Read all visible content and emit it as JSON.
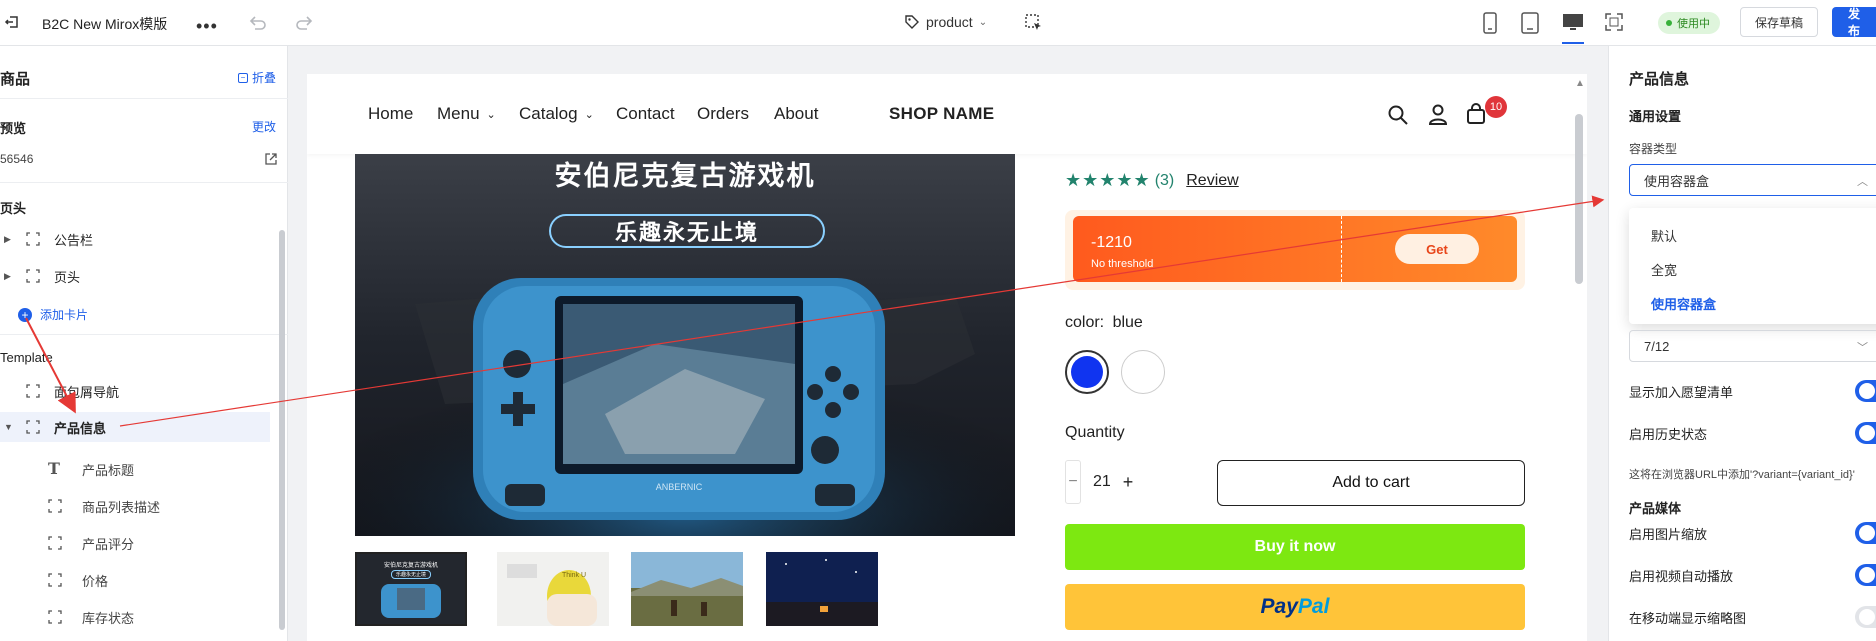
{
  "app": {
    "title": "B2C New Mirox模版",
    "page_selector": "product",
    "status": "使用中",
    "save_draft": "保存草稿",
    "publish": "发布"
  },
  "left_panel": {
    "header": "商品",
    "collapse": "折叠",
    "preview_label": "预览",
    "change": "更改",
    "product_id": "56546",
    "section_header": "页头",
    "header_items": [
      "公告栏",
      "页头"
    ],
    "add_card": "添加卡片",
    "template_label": "Template",
    "template_items": [
      "面包屑导航",
      "产品信息"
    ],
    "sub_items": [
      "产品标题",
      "商品列表描述",
      "产品评分",
      "价格",
      "库存状态"
    ]
  },
  "canvas": {
    "nav": [
      "Home",
      "Menu",
      "Catalog",
      "Contact",
      "Orders",
      "About"
    ],
    "shop_name": "SHOP NAME",
    "cart_count": "10",
    "hero_title": "安伯尼克复古游戏机",
    "hero_pill": "乐趣永无止境",
    "device_brand": "ANBERNIC",
    "rating_count": "(3)",
    "review_link": "Review",
    "coupon_amount": "-1210",
    "coupon_sub": "No threshold",
    "coupon_btn": "Get",
    "color_label": "color:",
    "color_value": "blue",
    "quantity_label": "Quantity",
    "quantity_value": "21",
    "minus": "−",
    "plus": "+",
    "add_to_cart": "Add to cart",
    "buy_now": "Buy it now",
    "paypal_pay": "Pay",
    "paypal_pal": "Pal",
    "thumb1_line1": "安伯尼克复古游戏机",
    "thumb1_line2": "乐趣永无止境",
    "thumb2_text": "Think U"
  },
  "right_panel": {
    "title": "产品信息",
    "general": "通用设置",
    "container_label": "容器类型",
    "container_value": "使用容器盒",
    "dropdown_options": [
      "默认",
      "全宽",
      "使用容器盒"
    ],
    "layout_value": "7/12",
    "toggles": [
      {
        "label": "显示加入愿望清单",
        "on": true
      },
      {
        "label": "启用历史状态",
        "on": true
      }
    ],
    "hint": "这将在浏览器URL中添加'?variant={variant_id}'",
    "media_header": "产品媒体",
    "media_toggles": [
      {
        "label": "启用图片缩放",
        "on": true
      },
      {
        "label": "启用视频自动播放",
        "on": true
      },
      {
        "label": "在移动端显示缩略图",
        "on": false
      }
    ]
  },
  "colors": {
    "accent": "#1f5fe8",
    "buy_now": "#7de811",
    "paypal": "#ffc439",
    "coupon": "#ff5a1e",
    "swatch_blue": "#1034f0",
    "annotation_arrow": "#e53935"
  }
}
